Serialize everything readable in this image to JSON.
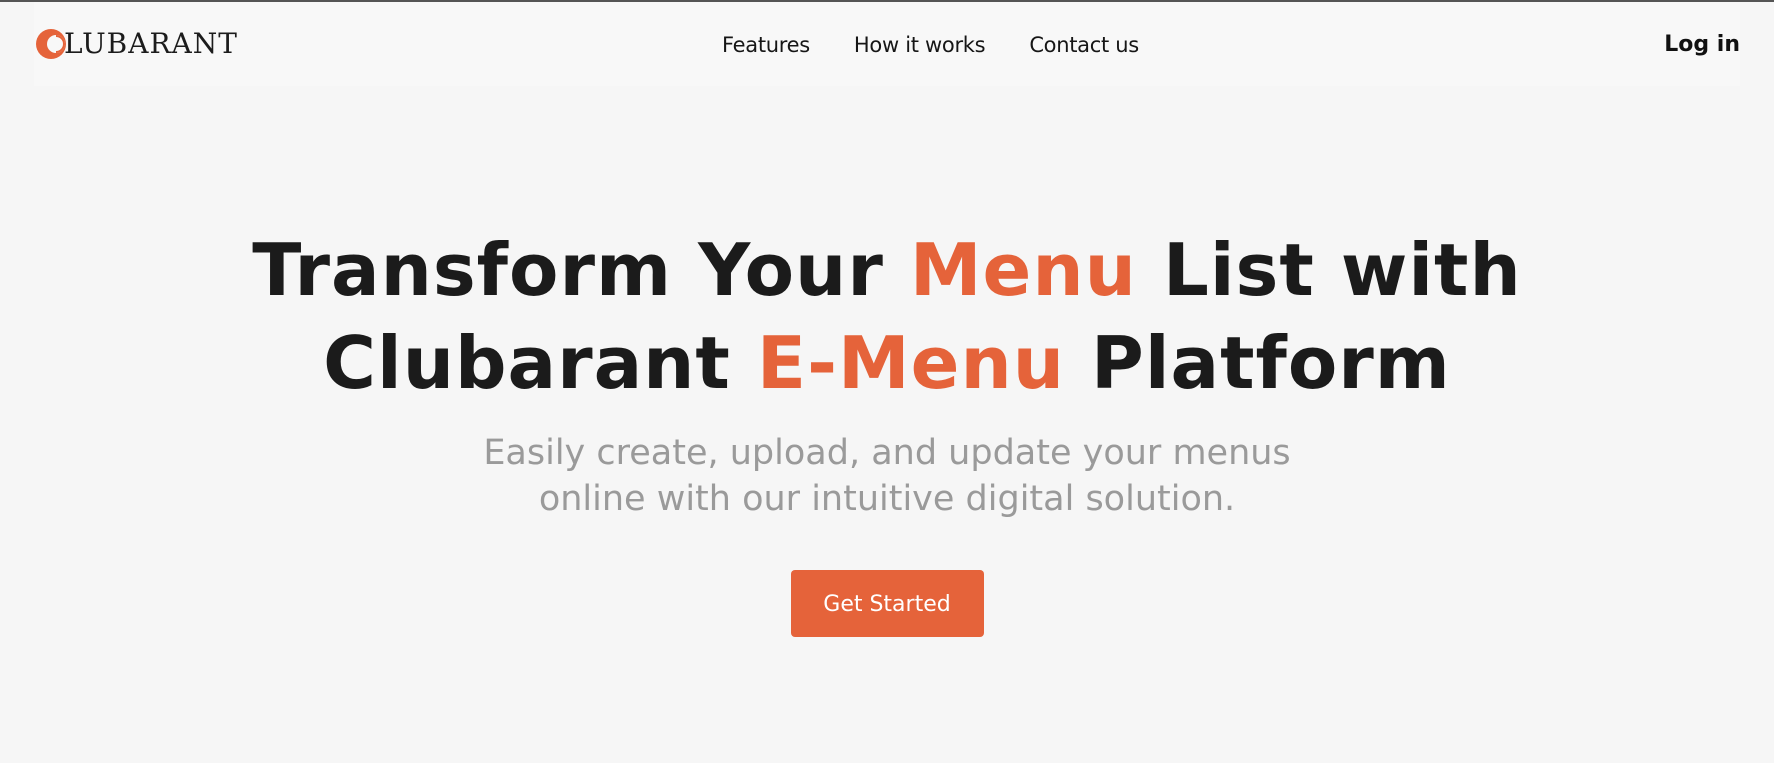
{
  "brand": {
    "name": "LUBARANT",
    "logo_icon": "clubarant-c-logo-icon",
    "accent_color": "#e5633a"
  },
  "nav": {
    "links": [
      {
        "label": "Features"
      },
      {
        "label": "How it works"
      },
      {
        "label": "Contact us"
      }
    ],
    "login_label": "Log in"
  },
  "hero": {
    "title_line1_part1": "Transform Your ",
    "title_line1_accent": "Menu",
    "title_line1_part2": " List with",
    "title_line2_part1": "Clubarant ",
    "title_line2_accent": "E-Menu",
    "title_line2_part2": " Platform",
    "subtitle": "Easily create, upload, and update your menus online with our intuitive digital solution.",
    "cta_label": "Get Started"
  }
}
